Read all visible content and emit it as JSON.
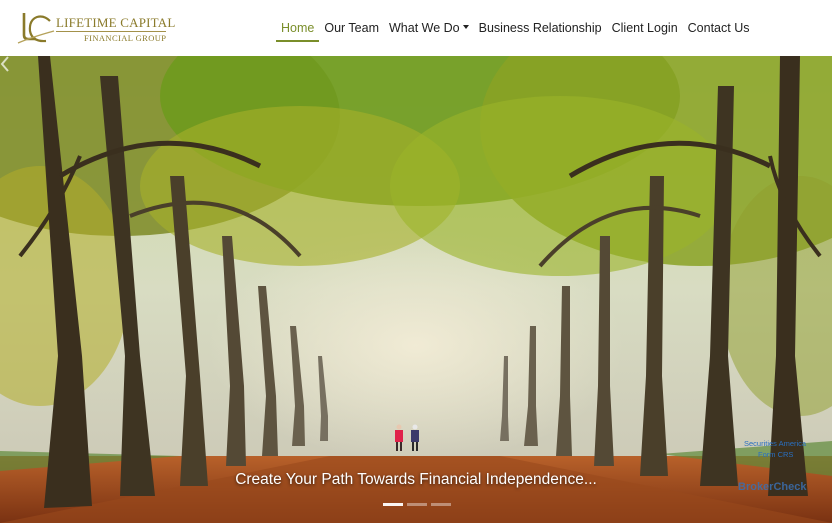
{
  "logo": {
    "monogram": "LC",
    "title": "LIFETIME CAPITAL",
    "subtitle": "FINANCIAL GROUP",
    "color": "#8a7a2a"
  },
  "nav": {
    "items": [
      {
        "label": "Home",
        "active": true
      },
      {
        "label": "Our Team",
        "active": false
      },
      {
        "label": "What We Do",
        "active": false,
        "dropdown": true
      },
      {
        "label": "Business Relationship",
        "active": false
      },
      {
        "label": "Client Login",
        "active": false
      },
      {
        "label": "Contact Us",
        "active": false
      }
    ],
    "active_color": "#7a8e2a"
  },
  "hero": {
    "caption": "Create Your Path Towards Financial Independence...",
    "slides": [
      {
        "active": true
      },
      {
        "active": false
      },
      {
        "active": false
      }
    ]
  },
  "broker_check": {
    "line1": "Securities America",
    "line2": "Form CRS",
    "logo_text": "BrokerCheck"
  }
}
